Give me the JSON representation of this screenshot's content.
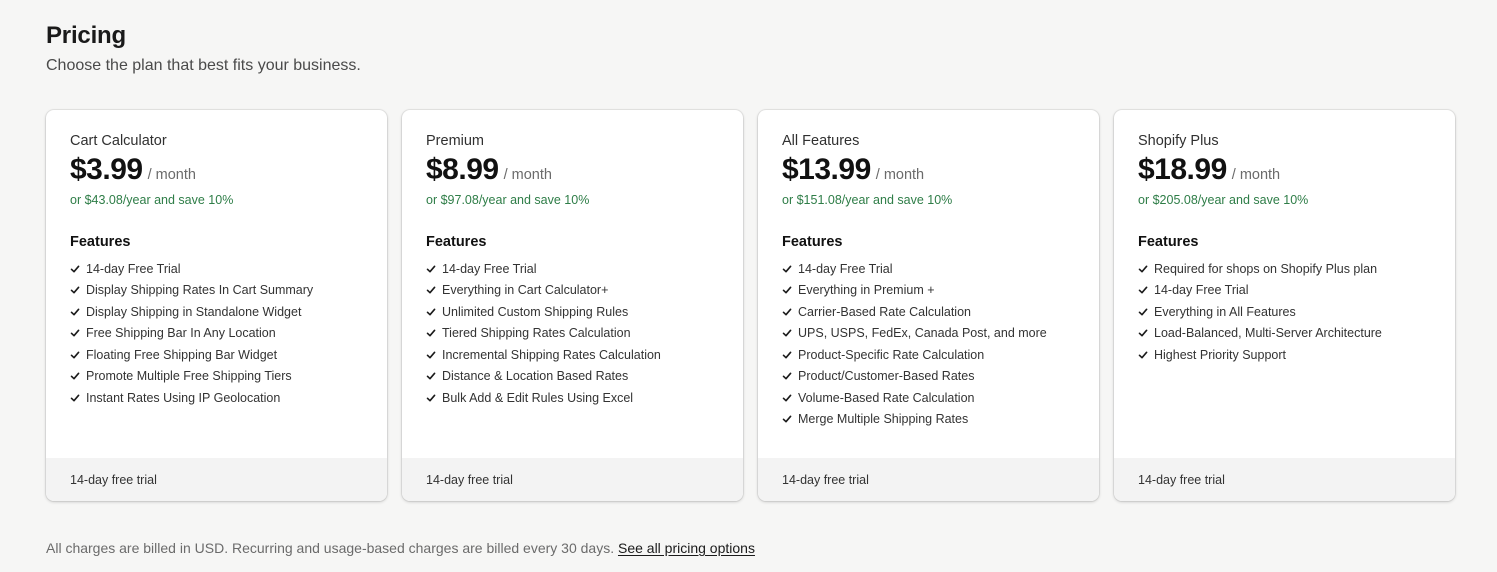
{
  "header": {
    "title": "Pricing",
    "subtitle": "Choose the plan that best fits your business."
  },
  "plans": [
    {
      "name": "Cart Calculator",
      "price": "$3.99",
      "period": "/ month",
      "yearly": "or $43.08/year and save 10%",
      "features_title": "Features",
      "features": [
        "14-day Free Trial",
        "Display Shipping Rates In Cart Summary",
        "Display Shipping in Standalone Widget",
        "Free Shipping Bar In Any Location",
        "Floating Free Shipping Bar Widget",
        "Promote Multiple Free Shipping Tiers",
        "Instant Rates Using IP Geolocation"
      ],
      "footer": "14-day free trial"
    },
    {
      "name": "Premium",
      "price": "$8.99",
      "period": "/ month",
      "yearly": "or $97.08/year and save 10%",
      "features_title": "Features",
      "features": [
        "14-day Free Trial",
        "Everything in Cart Calculator+",
        "Unlimited Custom Shipping Rules",
        "Tiered Shipping Rates Calculation",
        "Incremental Shipping Rates Calculation",
        "Distance & Location Based Rates",
        "Bulk Add & Edit Rules Using Excel"
      ],
      "footer": "14-day free trial"
    },
    {
      "name": "All Features",
      "price": "$13.99",
      "period": "/ month",
      "yearly": "or $151.08/year and save 10%",
      "features_title": "Features",
      "features": [
        "14-day Free Trial",
        "Everything in Premium +",
        "Carrier-Based Rate Calculation",
        "UPS, USPS, FedEx, Canada Post, and more",
        "Product-Specific Rate Calculation",
        "Product/Customer-Based Rates",
        "Volume-Based Rate Calculation",
        "Merge Multiple Shipping Rates"
      ],
      "footer": "14-day free trial"
    },
    {
      "name": "Shopify Plus",
      "price": "$18.99",
      "period": "/ month",
      "yearly": "or $205.08/year and save 10%",
      "features_title": "Features",
      "features": [
        "Required for shops on Shopify Plus plan",
        "14-day Free Trial",
        "Everything in All Features",
        "Load-Balanced, Multi-Server Architecture",
        "Highest Priority Support"
      ],
      "footer": "14-day free trial"
    }
  ],
  "footer_note": {
    "text": "All charges are billed in USD. Recurring and usage-based charges are billed every 30 days.",
    "link": "See all pricing options"
  },
  "icons": {
    "feature_bullet": "checkmark-icon"
  },
  "colors": {
    "background": "#f6f6f5",
    "yearly_savings": "#2e7d47",
    "footer_band": "#f3f3f3"
  }
}
